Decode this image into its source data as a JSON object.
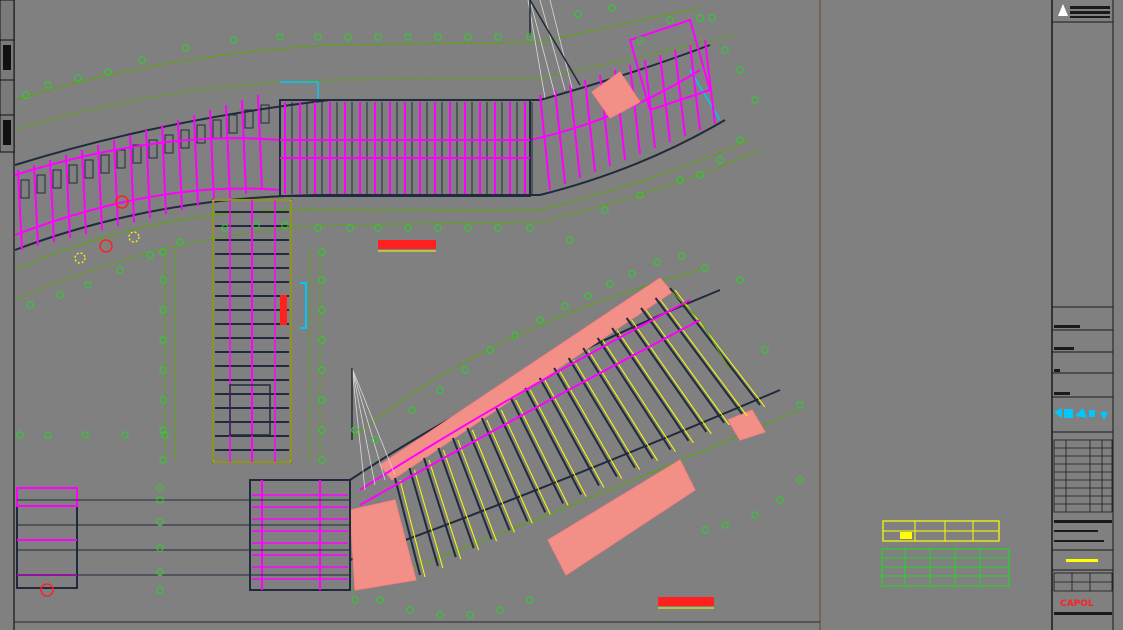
{
  "colors": {
    "background": "#808080",
    "axis_grid": "#5fa01a",
    "axis_bubble": "#29d12b",
    "beam": "#ff00ff",
    "wall": "#202a3c",
    "slab_hatch": "#f28f86",
    "yellow": "#ffff00",
    "cyan": "#00c8ff",
    "red": "#ff2020",
    "white": "#ffffff",
    "title_border": "#1a1a1a"
  },
  "drawing": {
    "labels": [
      {
        "id": "plan-title-upper",
        "text": ""
      },
      {
        "id": "plan-title-lower",
        "text": ""
      }
    ]
  },
  "title_block": {
    "company_logo": "CAPOL",
    "legend_symbols": [
      "cyan-symbol-row"
    ],
    "table_rows": 9
  },
  "icons": [
    "north-arrow-icon",
    "logo-triangle-icon"
  ]
}
